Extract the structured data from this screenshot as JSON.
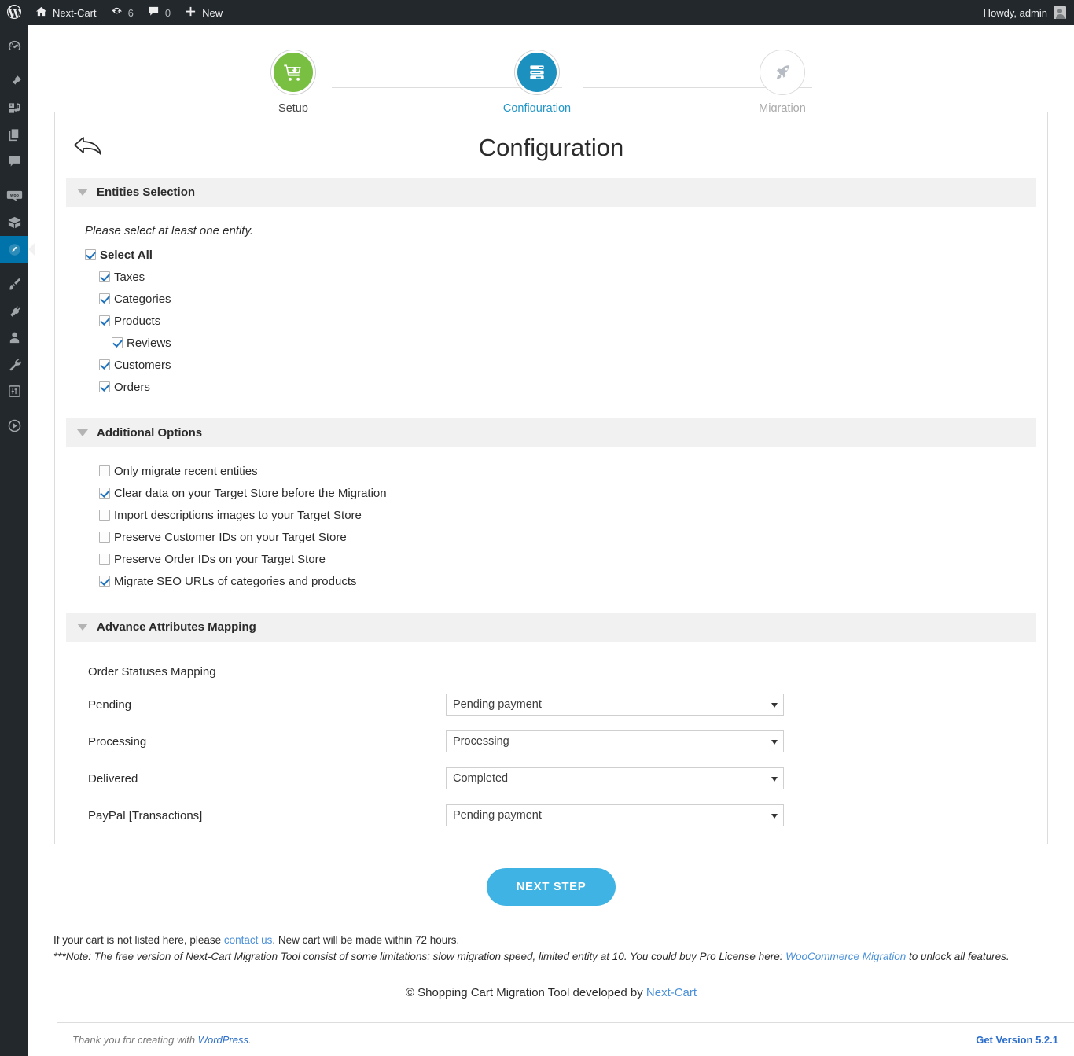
{
  "adminbar": {
    "site_name": "Next-Cart",
    "updates_count": "6",
    "comments_count": "0",
    "new_label": "New",
    "howdy": "Howdy, admin"
  },
  "sidebar": {
    "items": [
      {
        "name": "dashboard",
        "icon": "dashboard-icon"
      },
      {
        "name": "posts",
        "icon": "pin-icon"
      },
      {
        "name": "media",
        "icon": "media-icon"
      },
      {
        "name": "pages",
        "icon": "pages-icon"
      },
      {
        "name": "comments",
        "icon": "comment-icon"
      },
      {
        "name": "woocommerce",
        "icon": "woo-icon"
      },
      {
        "name": "products",
        "icon": "box-icon"
      },
      {
        "name": "cart-migration",
        "icon": "migration-icon",
        "current": true
      },
      {
        "name": "appearance",
        "icon": "brush-icon"
      },
      {
        "name": "plugins",
        "icon": "plug-icon"
      },
      {
        "name": "users",
        "icon": "user-icon"
      },
      {
        "name": "tools",
        "icon": "wrench-icon"
      },
      {
        "name": "settings",
        "icon": "settings-icon"
      },
      {
        "name": "collapse-menu",
        "icon": "play-icon"
      }
    ]
  },
  "stepper": {
    "steps": [
      {
        "label": "Setup",
        "state": "done",
        "icon": "cart-download-icon"
      },
      {
        "label": "Configuration",
        "state": "active",
        "icon": "server-list-icon"
      },
      {
        "label": "Migration",
        "state": "pending",
        "icon": "rocket-icon"
      }
    ]
  },
  "panel": {
    "title": "Configuration",
    "back_icon": "back-arrow-icon"
  },
  "entities": {
    "section_title": "Entities Selection",
    "hint": "Please select at least one entity.",
    "items": [
      {
        "label": "Select All",
        "checked": true,
        "indent": 0,
        "bold": true
      },
      {
        "label": "Taxes",
        "checked": true,
        "indent": 1,
        "bold": false
      },
      {
        "label": "Categories",
        "checked": true,
        "indent": 1,
        "bold": false
      },
      {
        "label": "Products",
        "checked": true,
        "indent": 1,
        "bold": false
      },
      {
        "label": "Reviews",
        "checked": true,
        "indent": 2,
        "bold": false
      },
      {
        "label": "Customers",
        "checked": true,
        "indent": 1,
        "bold": false
      },
      {
        "label": "Orders",
        "checked": true,
        "indent": 1,
        "bold": false
      }
    ]
  },
  "additional": {
    "section_title": "Additional Options",
    "items": [
      {
        "label": "Only migrate recent entities",
        "checked": false
      },
      {
        "label": "Clear data on your Target Store before the Migration",
        "checked": true
      },
      {
        "label": "Import descriptions images to your Target Store",
        "checked": false
      },
      {
        "label": "Preserve Customer IDs on your Target Store",
        "checked": false
      },
      {
        "label": "Preserve Order IDs on your Target Store",
        "checked": false
      },
      {
        "label": "Migrate SEO URLs of categories and products",
        "checked": true
      }
    ]
  },
  "mapping": {
    "section_title": "Advance Attributes Mapping",
    "caption": "Order Statuses Mapping",
    "rows": [
      {
        "label": "Pending",
        "value": "Pending payment"
      },
      {
        "label": "Processing",
        "value": "Processing"
      },
      {
        "label": "Delivered",
        "value": "Completed"
      },
      {
        "label": "PayPal [Transactions]",
        "value": "Pending payment"
      }
    ]
  },
  "actions": {
    "next_step": "NEXT STEP"
  },
  "notes": {
    "line1_a": "If your cart is not listed here, please ",
    "line1_link": "contact us",
    "line1_b": ". New cart will be made within 72 hours.",
    "line2_a": "***Note: The free version of Next-Cart Migration Tool consist of some limitations: slow migration speed, limited entity at 10. You could buy Pro License here: ",
    "line2_link": "WooCommerce Migration",
    "line2_b": " to unlock all features.",
    "credit_a": "© Shopping Cart Migration Tool developed by ",
    "credit_link": "Next-Cart"
  },
  "wpfooter": {
    "thanks_a": "Thank you for creating with ",
    "thanks_link": "WordPress",
    "thanks_b": ".",
    "version": "Get Version 5.2.1"
  },
  "colors": {
    "adminbar_bg": "#23282d",
    "accent_blue": "#3fb3e3",
    "step_green": "#79bf42",
    "step_blue": "#1c91bf",
    "link_blue": "#4a90d9",
    "check_blue": "#1e73be",
    "section_bg": "#f1f1f1"
  }
}
